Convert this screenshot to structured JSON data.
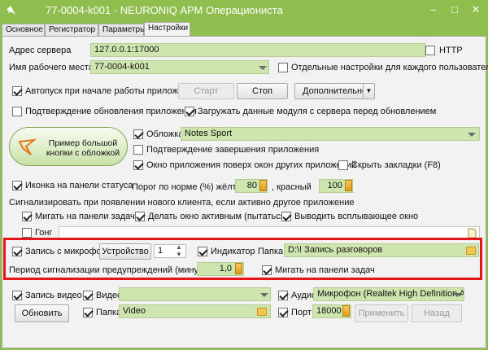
{
  "window": {
    "title": "77-0004-k001 - NEURONIQ АРМ Операциониста",
    "buttons": {
      "minimize": "–",
      "maximize": "□",
      "close": "✕"
    }
  },
  "tabs": [
    "Основное",
    "Регистратор",
    "Параметры",
    "Настройки"
  ],
  "server": {
    "label": "Адрес сервера",
    "value": "127.0.0.1:17000",
    "http_label": "HTTP"
  },
  "workplace": {
    "label": "Имя рабочего места",
    "value": "77-0004-k001",
    "per_user_label": "Отдельные настройки для каждого пользователя ОС"
  },
  "autostart": {
    "label": "Автопуск при начале работы приложения",
    "start": "Старт",
    "stop": "Стоп",
    "more": "Дополнительно"
  },
  "confirm_update": {
    "label": "Подтверждение обновления приложения"
  },
  "load_module": {
    "label": "Загружать данные модуля с сервера перед обновлением"
  },
  "big_button": {
    "line1": "Пример большой",
    "line2": "кнопки с обложкой"
  },
  "skin": {
    "label": "Обложка",
    "value": "Notes Sport"
  },
  "confirm_exit": {
    "label": "Подтверждение завершения приложения"
  },
  "on_top": {
    "label": "Окно приложения поверх окон других приложений"
  },
  "hide_tabs": {
    "label": "Скрыть закладки (F8)"
  },
  "tray": {
    "label": "Иконка на панели статуса",
    "threshold_label": "Порог по норме (%) жёлтый",
    "yellow": "80",
    "red_label": ", красный",
    "red": "100"
  },
  "signal": {
    "heading": "Сигнализировать при появлении нового клиента, если активно другое приложение",
    "blink_taskbar": "Мигать на панели задач",
    "activate": "Делать окно активным (пытаться)",
    "popup": "Выводить всплывающее окно",
    "gong": "Гонг"
  },
  "mic": {
    "label": "Запись с микрофона",
    "device": "Устройство",
    "device_value": "1",
    "indicator": "Индикатор",
    "folder_label": "Папка",
    "folder_value": "D:\\! Запись разговоров"
  },
  "warn": {
    "label": "Период сигнализации предупреждений (минуты)",
    "value": "1,0",
    "blink_taskbar": "Мигать на панели задач"
  },
  "video": {
    "record_label": "Запись видео",
    "video_label": "Видео",
    "audio_label": "Аудио",
    "audio_value": "Микрофон (Realtek High Definition Audio)",
    "refresh": "Обновить",
    "folder_label": "Папка",
    "folder_value": "Video",
    "port_label": "Порт",
    "port_value": "18000",
    "apply": "Применить",
    "back": "Назад"
  }
}
